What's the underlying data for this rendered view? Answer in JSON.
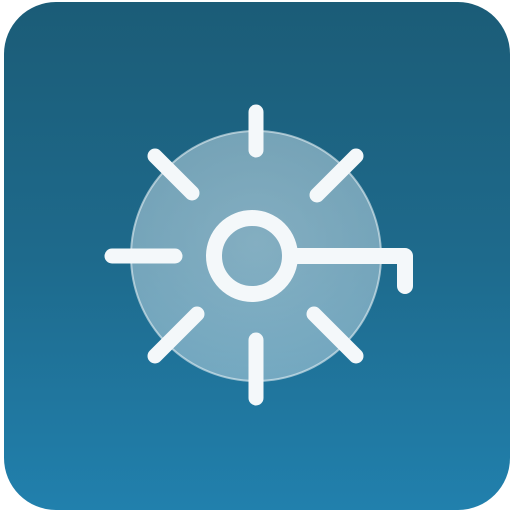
{
  "app_icon": {
    "icon": "sun-key-icon",
    "colors": {
      "background_top": "#1b5c77",
      "background_bottom": "#2180ad",
      "disc_fill": "#c9dde6",
      "glyph_stroke": "#f4f8fa"
    }
  }
}
